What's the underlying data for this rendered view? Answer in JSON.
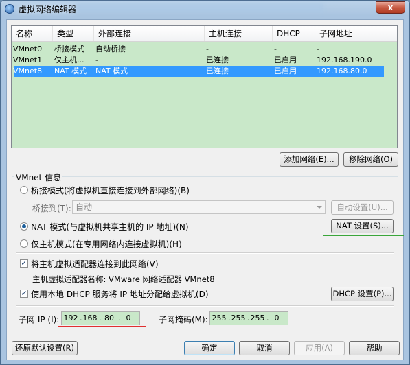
{
  "window": {
    "title": "虚拟网络编辑器",
    "close_label": "x"
  },
  "list": {
    "headers": [
      "名称",
      "类型",
      "外部连接",
      "主机连接",
      "DHCP",
      "子网地址"
    ],
    "rows": [
      [
        "VMnet0",
        "桥接模式",
        "自动桥接",
        "-",
        "-",
        "-"
      ],
      [
        "VMnet1",
        "仅主机...",
        "-",
        "已连接",
        "已启用",
        "192.168.190.0"
      ],
      [
        "VMnet8",
        "NAT 模式",
        "NAT 模式",
        "已连接",
        "已启用",
        "192.168.80.0"
      ]
    ],
    "selected_row": 2
  },
  "buttons": {
    "add_network": "添加网络(E)...",
    "remove_network": "移除网络(O)",
    "auto_settings": "自动设置(U)...",
    "nat_settings": "NAT 设置(S)...",
    "dhcp_settings": "DHCP 设置(P)...",
    "restore_defaults": "还原默认设置(R)",
    "ok": "确定",
    "cancel": "取消",
    "apply": "应用(A)",
    "help": "帮助"
  },
  "vmnet_info": {
    "group_label": "VMnet 信息",
    "bridged_label": "桥接模式(将虚拟机直接连接到外部网络)(B)",
    "bridged_to_label": "桥接到(T):",
    "bridged_to_value": "自动",
    "nat_label": "NAT 模式(与虚拟机共享主机的 IP 地址)(N)",
    "hostonly_label": "仅主机模式(在专用网络内连接虚拟机)(H)",
    "selected_mode": "nat",
    "connect_adapter_label": "将主机虚拟适配器连接到此网络(V)",
    "connect_adapter_checked": true,
    "adapter_name_label": "主机虚拟适配器名称: VMware 网络适配器 VMnet8",
    "use_dhcp_label": "使用本地 DHCP 服务将 IP 地址分配给虚拟机(D)",
    "use_dhcp_checked": true,
    "subnet_ip_label": "子网 IP (I):",
    "subnet_ip": [
      "192",
      "168",
      "80",
      "0"
    ],
    "subnet_mask_label": "子网掩码(M):",
    "subnet_mask": [
      "255",
      "255",
      "255",
      "0"
    ]
  },
  "colors": {
    "list_bg": "#c9e8c9",
    "selection": "#3399ff",
    "annotation_red": "#e03030",
    "annotation_green": "#3aa63a"
  }
}
